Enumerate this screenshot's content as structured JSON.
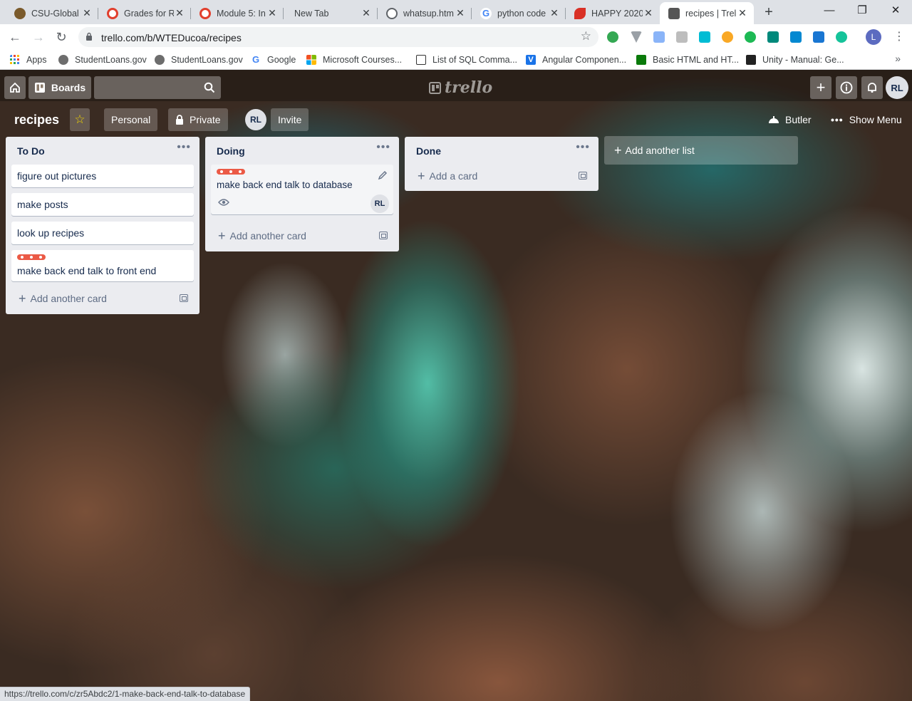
{
  "browser": {
    "tabs": [
      {
        "title": "CSU-Global",
        "icon": "csu-global-icon",
        "color": "#7a5a2b",
        "active": false
      },
      {
        "title": "Grades for R",
        "icon": "canvas-icon",
        "color": "#e13f2d",
        "active": false
      },
      {
        "title": "Module 5: In",
        "icon": "canvas-icon",
        "color": "#e13f2d",
        "active": false
      },
      {
        "title": "New Tab",
        "icon": "",
        "color": "",
        "active": false
      },
      {
        "title": "whatsup.htm",
        "icon": "globe-icon",
        "color": "#5f6368",
        "active": false
      },
      {
        "title": "python code",
        "icon": "google-icon",
        "color": "#4285f4",
        "active": false
      },
      {
        "title": "HAPPY 2020",
        "icon": "red-leaf-icon",
        "color": "#d93025",
        "active": false
      },
      {
        "title": "recipes | Trel",
        "icon": "trello-icon",
        "color": "#555555",
        "active": true
      }
    ],
    "url": "trello.com/b/WTEDucoa/recipes",
    "profile_initial": "L",
    "bookmarks": [
      {
        "label": "Apps",
        "icon": "apps-grid-icon",
        "color": "#4285f4"
      },
      {
        "label": "StudentLoans.gov",
        "icon": "seal-icon",
        "color": "#6d6d6d"
      },
      {
        "label": "StudentLoans.gov",
        "icon": "seal-icon",
        "color": "#6d6d6d"
      },
      {
        "label": "Google",
        "icon": "google-icon",
        "color": "#4285f4"
      },
      {
        "label": "Microsoft Courses...",
        "icon": "microsoft-icon",
        "color": "#f25022"
      },
      {
        "label": "List of SQL Comma...",
        "icon": "document-icon",
        "color": "#333333"
      },
      {
        "label": "Angular Componen...",
        "icon": "v-icon",
        "color": "#1a73e8"
      },
      {
        "label": "Basic HTML and HT...",
        "icon": "freecodecamp-icon",
        "color": "#0a7a0a"
      },
      {
        "label": "Unity - Manual: Ge...",
        "icon": "unity-icon",
        "color": "#222222"
      }
    ],
    "status_url": "https://trello.com/c/zr5Abdc2/1-make-back-end-talk-to-database"
  },
  "header": {
    "boards_label": "Boards",
    "user_initials": "RL"
  },
  "board": {
    "name": "recipes",
    "team": "Personal",
    "visibility": "Private",
    "invite_label": "Invite",
    "butler_label": "Butler",
    "menu_label": "Show Menu",
    "add_list_label": "Add another list"
  },
  "lists": [
    {
      "title": "To Do",
      "cards": [
        {
          "text": "figure out pictures",
          "label": false
        },
        {
          "text": "make posts",
          "label": false
        },
        {
          "text": "look up recipes",
          "label": false
        },
        {
          "text": "make back end talk to front end",
          "label": true
        }
      ],
      "add_label": "Add another card"
    },
    {
      "title": "Doing",
      "cards": [
        {
          "text": "make back end talk to database",
          "label": true,
          "watching": true,
          "member": "RL"
        }
      ],
      "add_label": "Add another card"
    },
    {
      "title": "Done",
      "cards": [],
      "add_label": "Add a card"
    }
  ],
  "colors": {
    "label_red": "#eb5a46",
    "list_bg": "#ebecf0",
    "card_text": "#172b4d"
  }
}
